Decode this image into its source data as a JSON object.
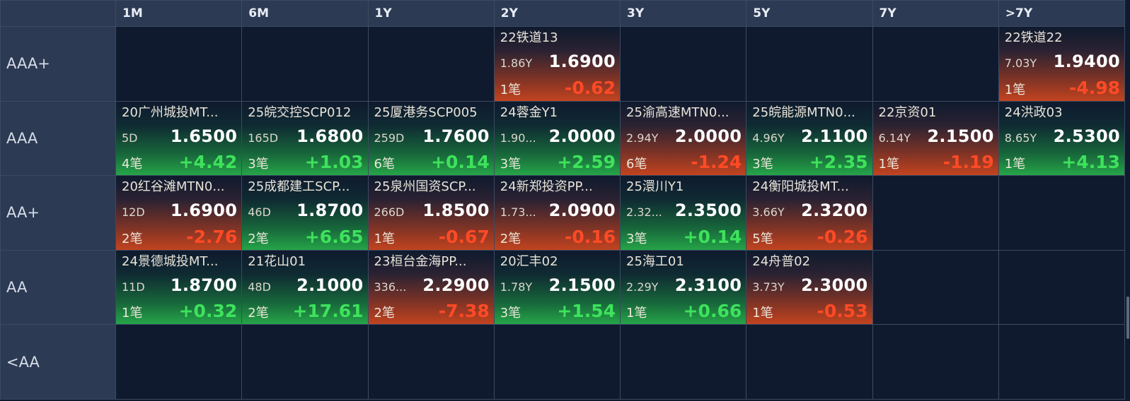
{
  "columns": [
    "1M",
    "6M",
    "1Y",
    "2Y",
    "3Y",
    "5Y",
    "7Y",
    ">7Y"
  ],
  "rows": [
    {
      "label": "AAA+",
      "cells": [
        null,
        null,
        null,
        {
          "name": "22铁道13",
          "term": "1.86Y",
          "yield": "1.6900",
          "count": "1笔",
          "change": "-0.62",
          "dir": "down"
        },
        null,
        null,
        null,
        {
          "name": "22铁道22",
          "term": "7.03Y",
          "yield": "1.9400",
          "count": "1笔",
          "change": "-4.98",
          "dir": "down"
        }
      ]
    },
    {
      "label": "AAA",
      "cells": [
        {
          "name": "20广州城投MT...",
          "term": "5D",
          "yield": "1.6500",
          "count": "4笔",
          "change": "+4.42",
          "dir": "up"
        },
        {
          "name": "25皖交控SCP012",
          "term": "165D",
          "yield": "1.6800",
          "count": "3笔",
          "change": "+1.03",
          "dir": "up"
        },
        {
          "name": "25厦港务SCP005",
          "term": "259D",
          "yield": "1.7600",
          "count": "6笔",
          "change": "+0.14",
          "dir": "up"
        },
        {
          "name": "24蓉金Y1",
          "term": "1.90...",
          "yield": "2.0000",
          "count": "3笔",
          "change": "+2.59",
          "dir": "up"
        },
        {
          "name": "25渝高速MTN0...",
          "term": "2.94Y",
          "yield": "2.0000",
          "count": "6笔",
          "change": "-1.24",
          "dir": "down"
        },
        {
          "name": "25皖能源MTN0...",
          "term": "4.96Y",
          "yield": "2.1100",
          "count": "3笔",
          "change": "+2.35",
          "dir": "up"
        },
        {
          "name": "22京资01",
          "term": "6.14Y",
          "yield": "2.1500",
          "count": "1笔",
          "change": "-1.19",
          "dir": "down"
        },
        {
          "name": "24洪政03",
          "term": "8.65Y",
          "yield": "2.5300",
          "count": "1笔",
          "change": "+4.13",
          "dir": "up"
        }
      ]
    },
    {
      "label": "AA+",
      "cells": [
        {
          "name": "20红谷滩MTN0...",
          "term": "12D",
          "yield": "1.6900",
          "count": "2笔",
          "change": "-2.76",
          "dir": "down"
        },
        {
          "name": "25成都建工SCP...",
          "term": "46D",
          "yield": "1.8700",
          "count": "2笔",
          "change": "+6.65",
          "dir": "up"
        },
        {
          "name": "25泉州国资SCP...",
          "term": "266D",
          "yield": "1.8500",
          "count": "1笔",
          "change": "-0.67",
          "dir": "down"
        },
        {
          "name": "24新郑投资PP...",
          "term": "1.73...",
          "yield": "2.0900",
          "count": "2笔",
          "change": "-0.16",
          "dir": "down"
        },
        {
          "name": "25澴川Y1",
          "term": "2.32...",
          "yield": "2.3500",
          "count": "3笔",
          "change": "+0.14",
          "dir": "up"
        },
        {
          "name": "24衡阳城投MT...",
          "term": "3.66Y",
          "yield": "2.3200",
          "count": "5笔",
          "change": "-0.26",
          "dir": "down"
        },
        null,
        null
      ]
    },
    {
      "label": "AA",
      "cells": [
        {
          "name": "24景德城投MT...",
          "term": "11D",
          "yield": "1.8700",
          "count": "1笔",
          "change": "+0.32",
          "dir": "up"
        },
        {
          "name": "21花山01",
          "term": "48D",
          "yield": "2.1000",
          "count": "2笔",
          "change": "+17.61",
          "dir": "up"
        },
        {
          "name": "23桓台金海PP...",
          "term": "336...",
          "yield": "2.2900",
          "count": "2笔",
          "change": "-7.38",
          "dir": "down"
        },
        {
          "name": "20汇丰02",
          "term": "1.78Y",
          "yield": "2.1500",
          "count": "3笔",
          "change": "+1.54",
          "dir": "up"
        },
        {
          "name": "25海工01",
          "term": "2.29Y",
          "yield": "2.3100",
          "count": "1笔",
          "change": "+0.66",
          "dir": "up"
        },
        {
          "name": "24舟普02",
          "term": "3.73Y",
          "yield": "2.3000",
          "count": "1笔",
          "change": "-0.53",
          "dir": "down"
        },
        null,
        null
      ]
    },
    {
      "label": "<AA",
      "cells": [
        null,
        null,
        null,
        null,
        null,
        null,
        null,
        null
      ]
    }
  ],
  "colors": {
    "up": "#3ee25c",
    "down": "#ff4a26",
    "header_bg": "#2c3a53",
    "cell_bg": "#0f1a2e",
    "grid_line": "#3c4a61"
  }
}
